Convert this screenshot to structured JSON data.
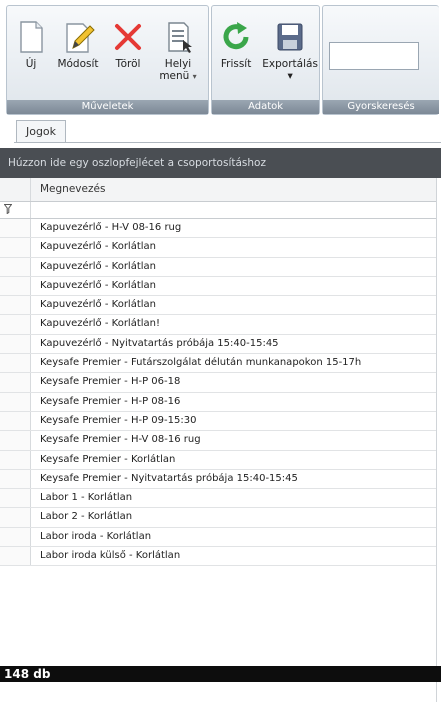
{
  "ribbon": {
    "groups": {
      "muveletek": {
        "label": "Műveletek"
      },
      "adatok": {
        "label": "Adatok"
      },
      "gyorskereses": {
        "label": "Gyorskeresés"
      }
    },
    "buttons": {
      "uj": "Új",
      "modosit": "Módosít",
      "torol": "Töröl",
      "helyi_line1": "Helyi",
      "helyi_line2": "menü",
      "frissit": "Frissít",
      "exportalas": "Exportálás"
    },
    "search": {
      "value": ""
    }
  },
  "tabs": [
    {
      "label": "Jogok"
    }
  ],
  "group_panel": {
    "text": "Húzzon ide egy oszlopfejlécet a csoportosításhoz"
  },
  "grid": {
    "column": "Megnevezés",
    "rows": [
      "Kapuvezérlő - H-V 08-16 rug",
      "Kapuvezérlő - Korlátlan",
      "Kapuvezérlő - Korlátlan",
      "Kapuvezérlő - Korlátlan",
      "Kapuvezérlő - Korlátlan",
      "Kapuvezérlő - Korlátlan!",
      "Kapuvezérlő - Nyitvatartás próbája 15:40-15:45",
      "Keysafe Premier - Futárszolgálat délután munkanapokon 15-17h",
      "Keysafe Premier - H-P 06-18",
      "Keysafe Premier - H-P 08-16",
      "Keysafe Premier - H-P 09-15:30",
      "Keysafe Premier - H-V 08-16 rug",
      "Keysafe Premier - Korlátlan",
      "Keysafe Premier - Nyitvatartás próbája 15:40-15:45",
      "Labor 1 - Korlátlan",
      "Labor 2 - Korlátlan",
      "Labor iroda - Korlátlan",
      "Labor iroda külső - Korlátlan"
    ]
  },
  "status": {
    "count": "148 db"
  }
}
